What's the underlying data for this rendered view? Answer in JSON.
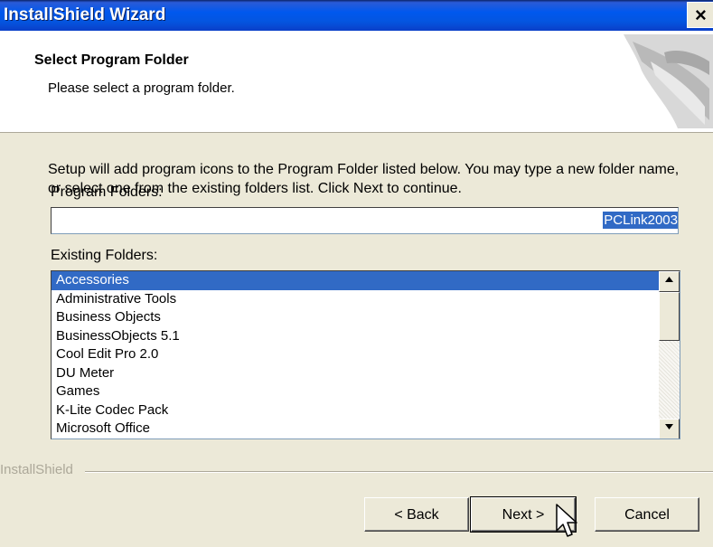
{
  "window": {
    "title": "InstallShield Wizard",
    "close_label": "×"
  },
  "header": {
    "title": "Select Program Folder",
    "subtitle": "Please select a program folder."
  },
  "description": "Setup will add program icons to the Program Folder listed below.  You may type a new folder name, or select one from the existing folders list.  Click Next to continue.",
  "program_folders": {
    "label": "Program Folders:",
    "value": "PCLink2003"
  },
  "existing_folders": {
    "label": "Existing Folders:",
    "selected_index": 0,
    "items": [
      "Accessories",
      "Administrative Tools",
      "Business Objects",
      "BusinessObjects 5.1",
      "Cool Edit Pro 2.0",
      "DU Meter",
      "Games",
      "K-Lite Codec Pack",
      "Microsoft Office"
    ]
  },
  "footer": {
    "brand": "InstallShield"
  },
  "buttons": {
    "back": "< Back",
    "next": "Next >",
    "cancel": "Cancel"
  }
}
